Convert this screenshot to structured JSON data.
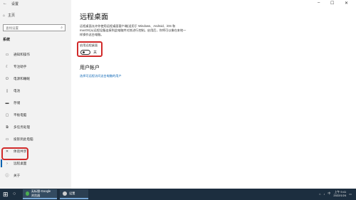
{
  "window": {
    "title": "设置"
  },
  "sidebar": {
    "home_label": "主页",
    "search_placeholder": "查找设置",
    "section_label": "系统",
    "items": [
      {
        "label": "通知和操作",
        "icon": "notification-icon"
      },
      {
        "label": "专注助手",
        "icon": "moon-icon"
      },
      {
        "label": "电源和睡眠",
        "icon": "power-icon"
      },
      {
        "label": "电池",
        "icon": "battery-icon"
      },
      {
        "label": "存储",
        "icon": "storage-icon"
      },
      {
        "label": "平板电脑",
        "icon": "tablet-icon"
      },
      {
        "label": "多任务处理",
        "icon": "multitask-icon"
      },
      {
        "label": "投影到此电脑",
        "icon": "projector-icon"
      },
      {
        "label": "体验共享",
        "icon": "share-icon"
      },
      {
        "label": "远程桌面",
        "icon": "remote-desktop-icon"
      },
      {
        "label": "关于",
        "icon": "info-icon"
      }
    ]
  },
  "main": {
    "title": "远程桌面",
    "description": "远程桌面允许你使用远程桌面客户端(适用于 Windows、Android、iOS 和 macOS)从远程设备连接到此电脑并对其进行控制。启用后，你将可以像在本地一样操作这台电脑。",
    "enable_label": "启用远程桌面",
    "toggle_state": "关",
    "toggle_on": false,
    "user_accounts_title": "用户帐户",
    "user_accounts_link": "选择可远程访问这台电脑的用户"
  },
  "taskbar": {
    "tasks": [
      {
        "label": "无标题-Google 浏览器",
        "icon_color": "#4caf50"
      },
      {
        "label": "设置",
        "icon_color": "#cfcfcf"
      }
    ],
    "time": "上午 9:41",
    "date": "2022/1/24",
    "lang": "中"
  },
  "colors": {
    "accent": "#0063b1",
    "highlight": "#d12a2a",
    "link": "#0b65b5",
    "taskbar": "#1c2e3f"
  }
}
